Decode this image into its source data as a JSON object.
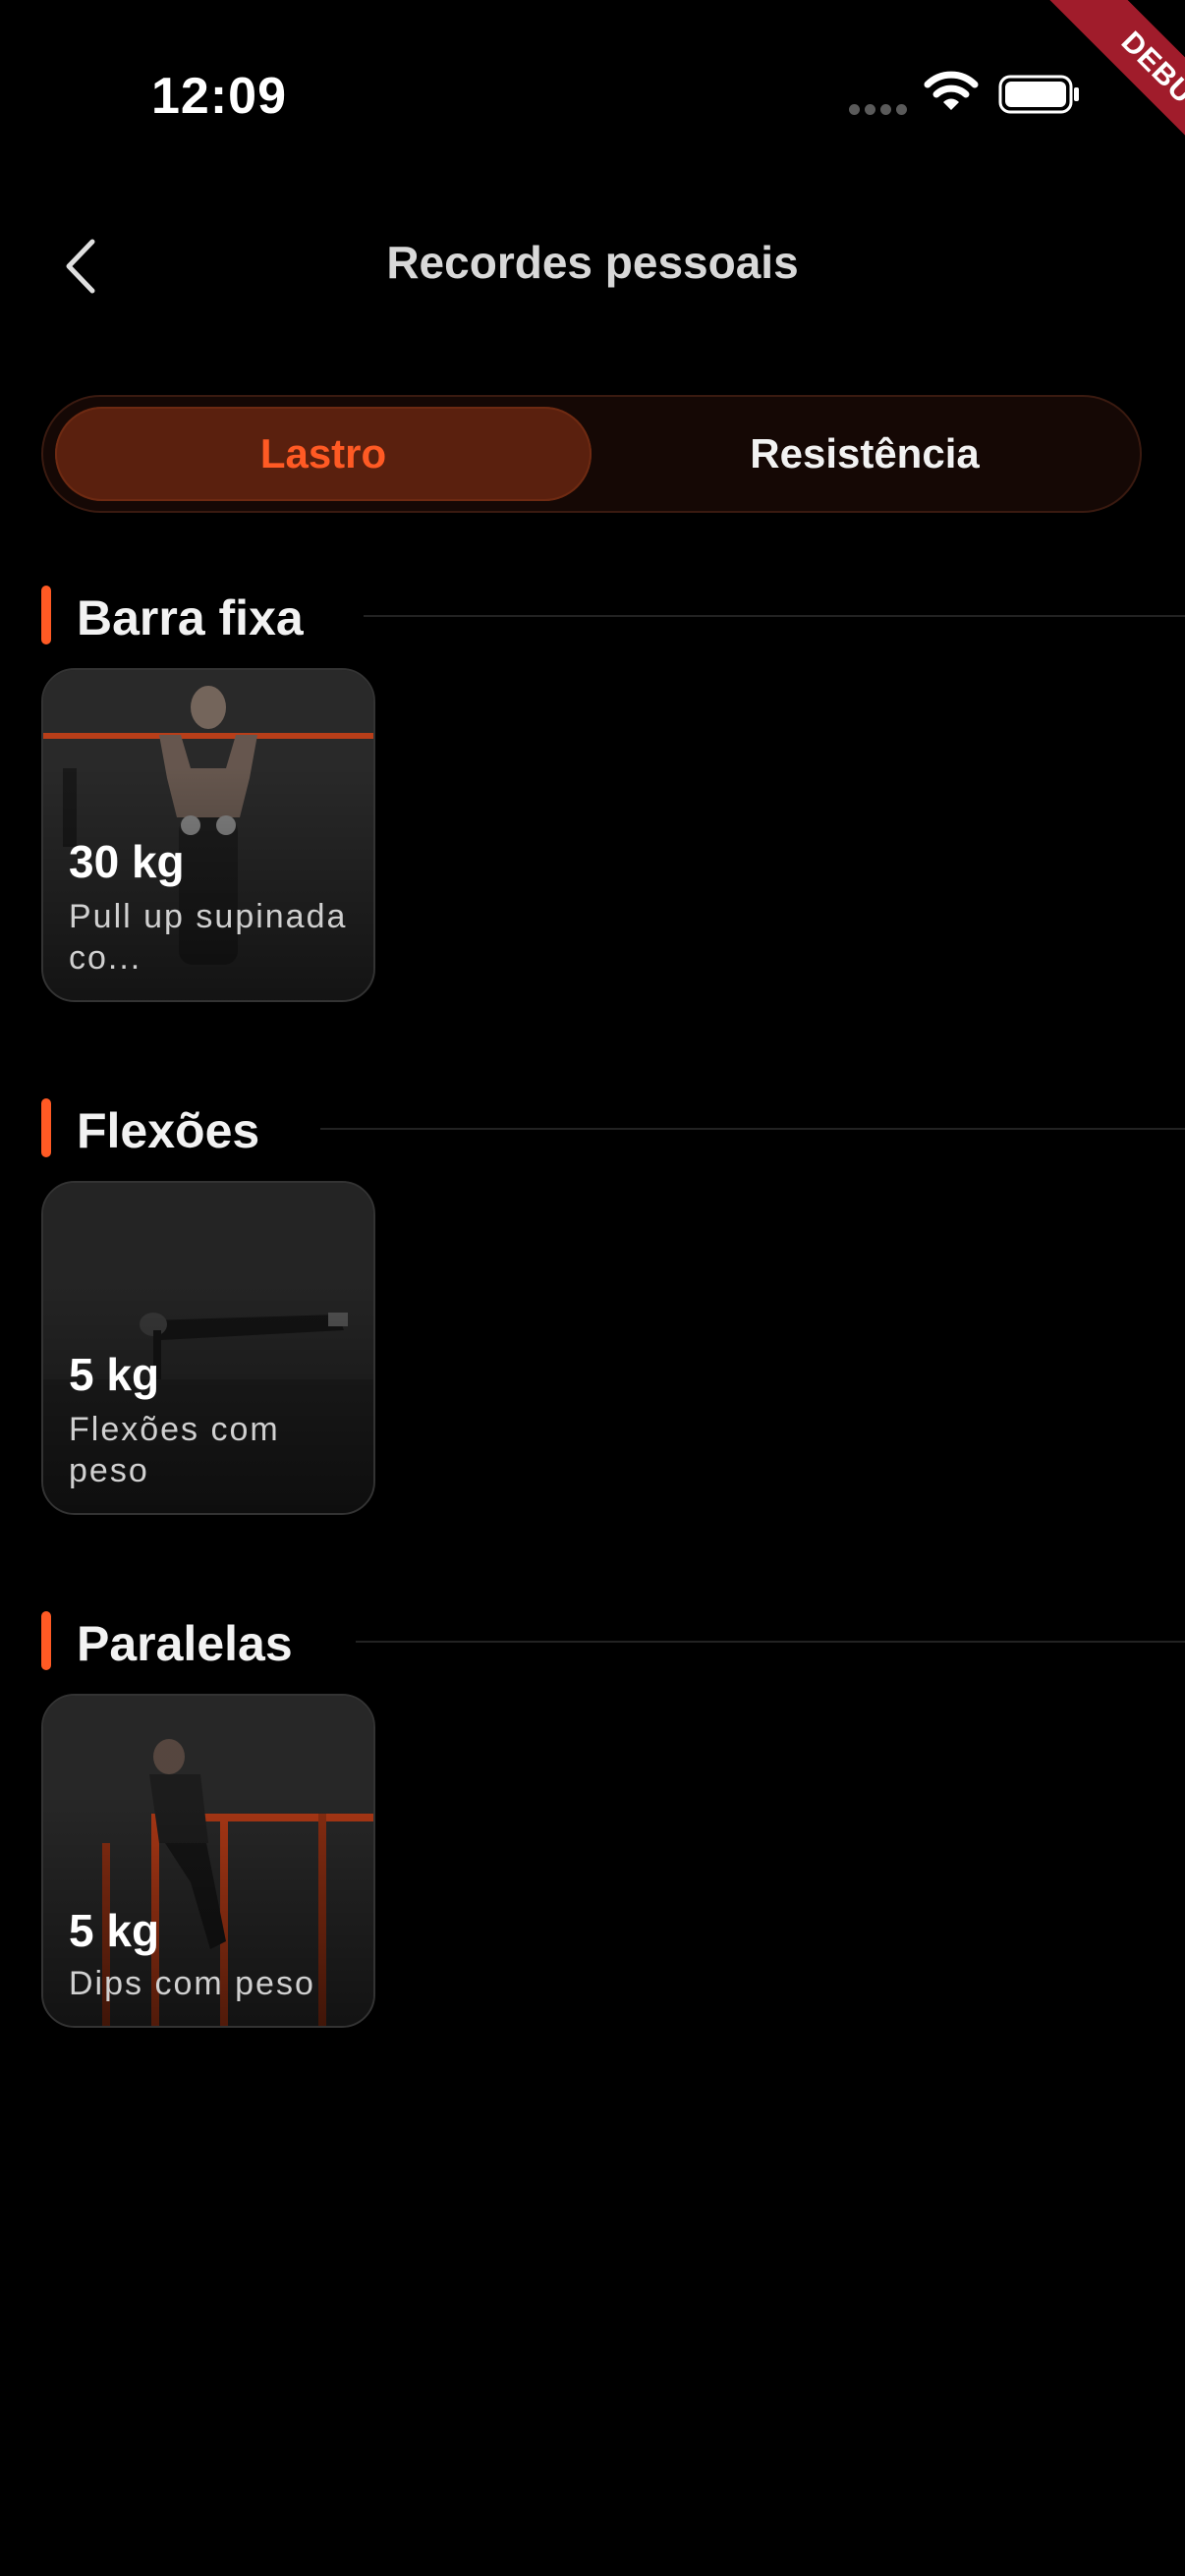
{
  "status_bar": {
    "time": "12:09"
  },
  "debug_banner": "DEBUG",
  "nav": {
    "title": "Recordes pessoais"
  },
  "tabs": [
    {
      "label": "Lastro",
      "active": true
    },
    {
      "label": "Resistência",
      "active": false
    }
  ],
  "colors": {
    "accent": "#ff5a24",
    "background": "#000000",
    "tab_active_bg": "#5a200e"
  },
  "sections": [
    {
      "title": "Barra fixa",
      "cards": [
        {
          "value": "30 kg",
          "name": "Pull up supinada co..."
        }
      ]
    },
    {
      "title": "Flexões",
      "cards": [
        {
          "value": "5 kg",
          "name": "Flexões com peso"
        }
      ]
    },
    {
      "title": "Paralelas",
      "cards": [
        {
          "value": "5 kg",
          "name": "Dips com peso"
        }
      ]
    }
  ]
}
